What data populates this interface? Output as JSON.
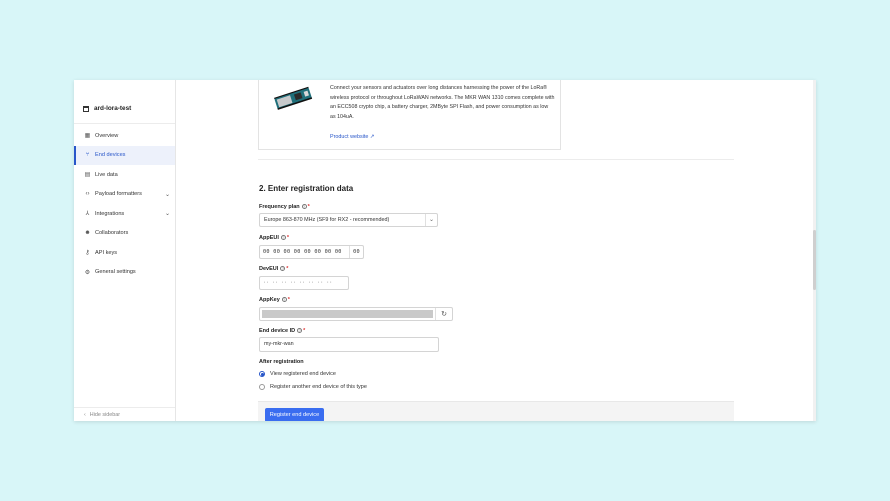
{
  "app": {
    "title": "ard-lora-test"
  },
  "sidebar": {
    "items": [
      {
        "label": "Overview",
        "icon": "dashboard-icon"
      },
      {
        "label": "End devices",
        "icon": "devices-icon",
        "active": true
      },
      {
        "label": "Live data",
        "icon": "list-icon"
      },
      {
        "label": "Payload formatters",
        "icon": "code-icon",
        "expandable": true
      },
      {
        "label": "Integrations",
        "icon": "integrations-icon",
        "expandable": true
      },
      {
        "label": "Collaborators",
        "icon": "people-icon"
      },
      {
        "label": "API keys",
        "icon": "key-icon"
      },
      {
        "label": "General settings",
        "icon": "gear-icon"
      }
    ],
    "hide_label": "Hide sidebar"
  },
  "device_card": {
    "description": "Connect your sensors and actuators over long distances harnessing the power of the LoRa® wireless protocol or throughout LoRaWAN networks. The MKR WAN 1310 comes complete with an ECC508 crypto chip, a battery charger, 2MByte SPI Flash, and power consumption as low as 104uA.",
    "link_label": "Product website"
  },
  "form": {
    "section_title": "2. Enter registration data",
    "frequency_plan": {
      "label": "Frequency plan",
      "value": "Europe 863-870 MHz (SF9 for RX2 - recommended)"
    },
    "app_eui": {
      "label": "AppEUI",
      "value": "00 00 00 00 00 00 00 00",
      "tail": "00"
    },
    "dev_eui": {
      "label": "DevEUI",
      "value": "·· ·· ·· ·· ·· ·· ·· ··"
    },
    "app_key": {
      "label": "AppKey"
    },
    "end_device_id": {
      "label": "End device ID",
      "value": "my-mkr-wan"
    },
    "after_registration": {
      "label": "After registration",
      "options": [
        {
          "label": "View registered end device",
          "checked": true
        },
        {
          "label": "Register another end device of this type",
          "checked": false
        }
      ]
    },
    "submit_label": "Register end device"
  },
  "colors": {
    "accent": "#2856c9",
    "button": "#3a6df0",
    "background": "#d8f6f8"
  }
}
